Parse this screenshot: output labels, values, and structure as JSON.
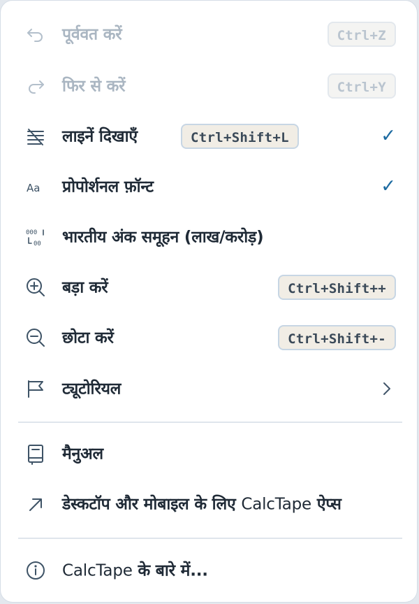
{
  "menu": {
    "undo": {
      "label": "पूर्ववत करें",
      "shortcut": "Ctrl+Z",
      "icon": "undo-icon",
      "enabled": false
    },
    "redo": {
      "label": "फिर से करें",
      "shortcut": "Ctrl+Y",
      "icon": "redo-icon",
      "enabled": false
    },
    "show_lines": {
      "label": "लाइनें दिखाएँ",
      "shortcut": "Ctrl+Shift+L",
      "icon": "lines-off-icon",
      "checked": true,
      "check_mark": "✓"
    },
    "proportional_font": {
      "label": "प्रोपोर्शनल फ़ॉन्ट",
      "icon": "font-aa-icon",
      "checked": true,
      "check_mark": "✓"
    },
    "indian_grouping": {
      "label": "भारतीय अंक समूहन (लाख/करोड़)",
      "icon": "digit-grouping-icon"
    },
    "zoom_in": {
      "label": "बड़ा करें",
      "shortcut": "Ctrl+Shift++",
      "icon": "zoom-in-icon"
    },
    "zoom_out": {
      "label": "छोटा करें",
      "shortcut": "Ctrl+Shift+-",
      "icon": "zoom-out-icon"
    },
    "tutorial": {
      "label": "ट्यूटोरियल",
      "icon": "flag-icon",
      "has_submenu": true
    },
    "manual": {
      "label": "मैनुअल",
      "icon": "book-icon"
    },
    "apps": {
      "label_prefix": "डेस्कटॉप और मोबाइल के लिए ",
      "label_brand": "CalcTape",
      "label_suffix": " ऐप्स",
      "icon": "external-arrow-icon"
    },
    "about": {
      "label_brand": "CalcTape",
      "label_suffix": " के बारे में...",
      "icon": "info-icon"
    }
  },
  "colors": {
    "accent": "#1c6aa0",
    "text": "#1f2a36",
    "disabled_text": "#aab6c2",
    "kbd_bg": "#f1ede5",
    "kbd_border": "#c7d6e4"
  }
}
